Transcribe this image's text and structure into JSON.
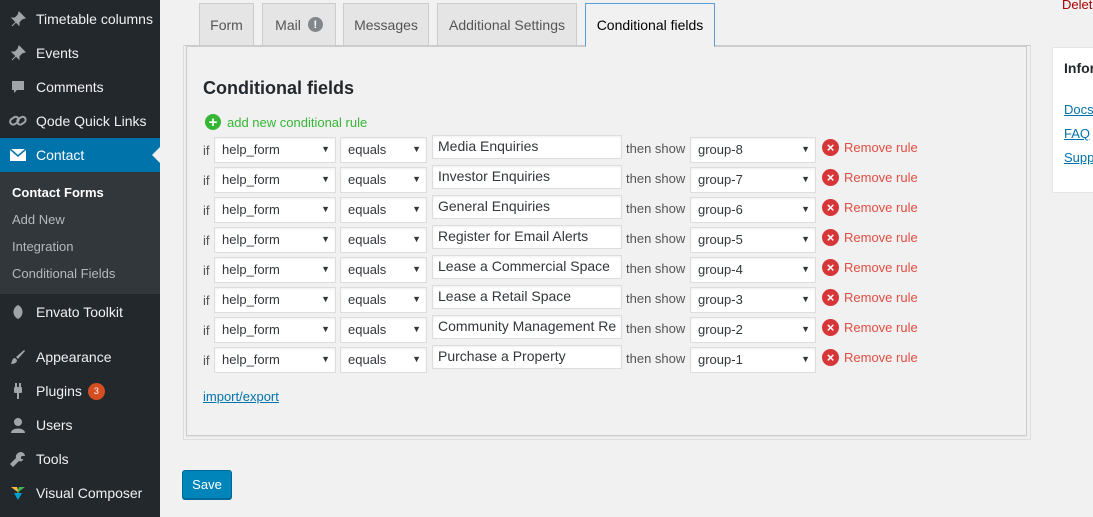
{
  "sidebar": {
    "items": [
      {
        "label": "Timetable columns",
        "icon": "pin-icon"
      },
      {
        "label": "Events",
        "icon": "pin-icon"
      },
      {
        "label": "Comments",
        "icon": "comment-icon"
      },
      {
        "label": "Qode Quick Links",
        "icon": "link-icon"
      },
      {
        "label": "Contact",
        "icon": "mail-icon"
      },
      {
        "label": "Envato Toolkit",
        "icon": "leaf-icon"
      },
      {
        "label": "Appearance",
        "icon": "brush-icon"
      },
      {
        "label": "Plugins",
        "icon": "plug-icon",
        "badge": "3"
      },
      {
        "label": "Users",
        "icon": "user-icon"
      },
      {
        "label": "Tools",
        "icon": "wrench-icon"
      },
      {
        "label": "Visual Composer",
        "icon": "vc-icon"
      }
    ],
    "submenu": [
      "Contact Forms",
      "Add New",
      "Integration",
      "Conditional Fields"
    ]
  },
  "tabs": {
    "form": "Form",
    "mail": "Mail",
    "mail_warning": "!",
    "messages": "Messages",
    "additional": "Additional Settings",
    "conditional": "Conditional fields"
  },
  "panel": {
    "title": "Conditional fields",
    "add_rule": "add new conditional rule",
    "if_label": "if",
    "then_label": "then show",
    "remove_label": "Remove rule",
    "import_export": "import/export"
  },
  "rules": [
    {
      "field": "help_form",
      "op": "equals",
      "value": "Media Enquiries",
      "group": "group-8"
    },
    {
      "field": "help_form",
      "op": "equals",
      "value": "Investor Enquiries",
      "group": "group-7"
    },
    {
      "field": "help_form",
      "op": "equals",
      "value": "General Enquiries",
      "group": "group-6"
    },
    {
      "field": "help_form",
      "op": "equals",
      "value": "Register for Email Alerts",
      "group": "group-5"
    },
    {
      "field": "help_form",
      "op": "equals",
      "value": "Lease a Commercial Space",
      "group": "group-4"
    },
    {
      "field": "help_form",
      "op": "equals",
      "value": "Lease a Retail Space",
      "group": "group-3"
    },
    {
      "field": "help_form",
      "op": "equals",
      "value": "Community Management Re",
      "group": "group-2"
    },
    {
      "field": "help_form",
      "op": "equals",
      "value": "Purchase a Property",
      "group": "group-1"
    }
  ],
  "save_label": "Save",
  "right": {
    "delete": "Delet",
    "info_title": "Infor",
    "links": [
      "Docs",
      "FAQ",
      "Supp"
    ]
  },
  "colors": {
    "sidebar_bg": "#23282d",
    "accent": "#0073aa",
    "add_green": "#35b635",
    "remove_red": "#e14d43",
    "button_blue": "#0085ba"
  }
}
